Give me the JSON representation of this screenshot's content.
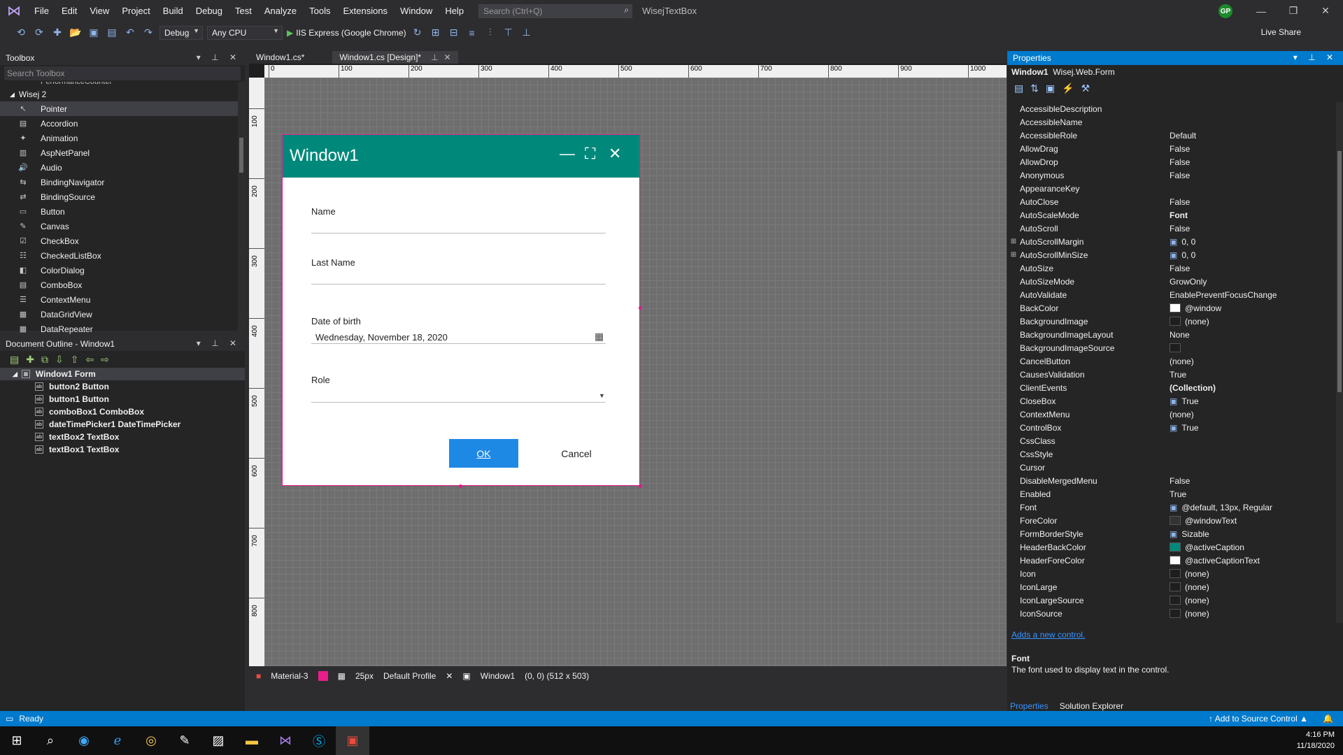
{
  "menubar": {
    "items": [
      "File",
      "Edit",
      "View",
      "Project",
      "Build",
      "Debug",
      "Test",
      "Analyze",
      "Tools",
      "Extensions",
      "Window",
      "Help"
    ],
    "search_placeholder": "Search (Ctrl+Q)",
    "solution_name": "WisejTextBox",
    "avatar_initials": "GP"
  },
  "toolbar": {
    "config": "Debug",
    "platform": "Any CPU",
    "run_target": "IIS Express (Google Chrome)",
    "live_share": "Live Share"
  },
  "toolbox": {
    "title": "Toolbox",
    "search_placeholder": "Search Toolbox",
    "partial_top": "PerformanceCounter",
    "group": "Wisej 2",
    "items": [
      "Pointer",
      "Accordion",
      "Animation",
      "AspNetPanel",
      "Audio",
      "BindingNavigator",
      "BindingSource",
      "Button",
      "Canvas",
      "CheckBox",
      "CheckedListBox",
      "ColorDialog",
      "ComboBox",
      "ContextMenu",
      "DataGridView",
      "DataRepeater"
    ]
  },
  "outline": {
    "title": "Document Outline - Window1",
    "root": "Window1  Form",
    "children": [
      "button2  Button",
      "button1  Button",
      "comboBox1  ComboBox",
      "dateTimePicker1  DateTimePicker",
      "textBox2  TextBox",
      "textBox1  TextBox"
    ]
  },
  "editor": {
    "tabs": [
      "Window1.cs*",
      "Window1.cs [Design]*"
    ],
    "ruler_h": [
      "0",
      "100",
      "200",
      "300",
      "400",
      "500",
      "600",
      "700",
      "800",
      "900",
      "1000"
    ],
    "ruler_v": [
      "100",
      "200",
      "300",
      "400",
      "500",
      "600",
      "700",
      "800"
    ],
    "form": {
      "title": "Window1",
      "name_label": "Name",
      "lastname_label": "Last Name",
      "dob_label": "Date of birth",
      "dob_value": "Wednesday, November 18, 2020",
      "role_label": "Role",
      "ok": "OK",
      "cancel": "Cancel"
    },
    "status": {
      "theme": "Material-3",
      "grid": "25px",
      "profile": "Default Profile",
      "selected": "Window1",
      "location": "(0, 0) (512 x 503)"
    }
  },
  "properties": {
    "title": "Properties",
    "object_name": "Window1",
    "object_type": "Wisej.Web.Form",
    "rows": [
      {
        "name": "AccessibleDescription",
        "value": ""
      },
      {
        "name": "AccessibleName",
        "value": ""
      },
      {
        "name": "AccessibleRole",
        "value": "Default"
      },
      {
        "name": "AllowDrag",
        "value": "False"
      },
      {
        "name": "AllowDrop",
        "value": "False"
      },
      {
        "name": "Anonymous",
        "value": "False"
      },
      {
        "name": "AppearanceKey",
        "value": ""
      },
      {
        "name": "AutoClose",
        "value": "False"
      },
      {
        "name": "AutoScaleMode",
        "value": "Font",
        "bold": true
      },
      {
        "name": "AutoScroll",
        "value": "False"
      },
      {
        "name": "AutoScrollMargin",
        "value": "0, 0",
        "expand": true,
        "icon": true
      },
      {
        "name": "AutoScrollMinSize",
        "value": "0, 0",
        "expand": true,
        "icon": true
      },
      {
        "name": "AutoSize",
        "value": "False"
      },
      {
        "name": "AutoSizeMode",
        "value": "GrowOnly"
      },
      {
        "name": "AutoValidate",
        "value": "EnablePreventFocusChange"
      },
      {
        "name": "BackColor",
        "value": "@window",
        "swatch": "#ffffff"
      },
      {
        "name": "BackgroundImage",
        "value": "(none)",
        "swatch": "#1e1e1e"
      },
      {
        "name": "BackgroundImageLayout",
        "value": "None"
      },
      {
        "name": "BackgroundImageSource",
        "value": "",
        "swatch": "#1e1e1e"
      },
      {
        "name": "CancelButton",
        "value": "(none)"
      },
      {
        "name": "CausesValidation",
        "value": "True"
      },
      {
        "name": "ClientEvents",
        "value": "(Collection)",
        "bold": true
      },
      {
        "name": "CloseBox",
        "value": "True",
        "icon": true
      },
      {
        "name": "ContextMenu",
        "value": "(none)"
      },
      {
        "name": "ControlBox",
        "value": "True",
        "icon": true
      },
      {
        "name": "CssClass",
        "value": ""
      },
      {
        "name": "CssStyle",
        "value": ""
      },
      {
        "name": "Cursor",
        "value": ""
      },
      {
        "name": "DisableMergedMenu",
        "value": "False"
      },
      {
        "name": "Enabled",
        "value": "True"
      },
      {
        "name": "Font",
        "value": "@default, 13px, Regular",
        "icon": true
      },
      {
        "name": "ForeColor",
        "value": "@windowText",
        "swatch": "#333333"
      },
      {
        "name": "FormBorderStyle",
        "value": "Sizable",
        "icon": true
      },
      {
        "name": "HeaderBackColor",
        "value": "@activeCaption",
        "swatch": "#00897b"
      },
      {
        "name": "HeaderForeColor",
        "value": "@activeCaptionText",
        "swatch": "#ffffff"
      },
      {
        "name": "Icon",
        "value": "(none)",
        "swatch": "#1e1e1e"
      },
      {
        "name": "IconLarge",
        "value": "(none)",
        "swatch": "#1e1e1e"
      },
      {
        "name": "IconLargeSource",
        "value": "(none)",
        "swatch": "#1e1e1e"
      },
      {
        "name": "IconSource",
        "value": "(none)",
        "swatch": "#1e1e1e"
      }
    ],
    "add_control_link": "Adds a new control.",
    "desc_title": "Font",
    "desc_text": "The font used to display text in the control.",
    "tabs": [
      "Properties",
      "Solution Explorer"
    ]
  },
  "statusbar": {
    "status": "Ready",
    "source_control": "Add to Source Control"
  },
  "taskbar": {
    "time": "4:16 PM",
    "date": "11/18/2020"
  }
}
